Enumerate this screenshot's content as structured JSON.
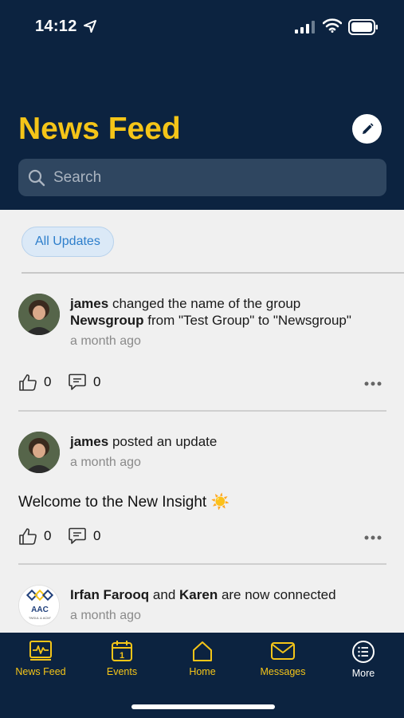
{
  "status": {
    "time": "14:12"
  },
  "header": {
    "title": "News Feed"
  },
  "search": {
    "placeholder": "Search"
  },
  "filter": {
    "label": "All Updates"
  },
  "feed": [
    {
      "user": "james",
      "action_pre": "changed the name of the group",
      "group": "Newsgroup",
      "action_post": "from \"Test Group\" to \"Newsgroup\"",
      "time": "a month ago",
      "likes": "0",
      "comments": "0"
    },
    {
      "user": "james",
      "action": "posted an update",
      "time": "a month ago",
      "body": "Welcome to the New Insight ☀️",
      "likes": "0",
      "comments": "0"
    },
    {
      "user": "Irfan Farooq",
      "conj": "and",
      "user2": "Karen",
      "action": "are now connected",
      "time": "a month ago",
      "avatar_text": "AAC",
      "avatar_sub": "\"INSUL & ACM\""
    }
  ],
  "tabs": [
    {
      "label": "News Feed",
      "icon": "activity-icon"
    },
    {
      "label": "Events",
      "icon": "calendar-icon",
      "day": "1"
    },
    {
      "label": "Home",
      "icon": "home-icon"
    },
    {
      "label": "Messages",
      "icon": "envelope-icon"
    },
    {
      "label": "More",
      "icon": "menu-list-icon"
    }
  ],
  "colors": {
    "header_bg": "#0c2340",
    "accent": "#f5c518",
    "chip_text": "#2d7ecb"
  }
}
